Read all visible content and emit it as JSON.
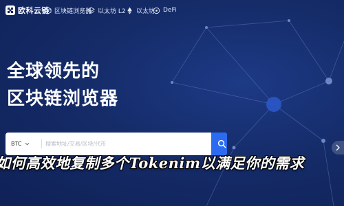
{
  "nav": {
    "brand": "欧科云链",
    "items": [
      {
        "label": "区块链浏览器",
        "icon": "cube-icon"
      },
      {
        "label": "以太坊 L2",
        "icon": "layers-icon"
      },
      {
        "label": "以太坊",
        "icon": "ethereum-icon"
      },
      {
        "label": "DeFi",
        "icon": "defi-icon"
      }
    ]
  },
  "hero": {
    "line1": "全球领先的",
    "line2": "区块链浏览器"
  },
  "search": {
    "coin": "BTC",
    "placeholder": "搜索地址/交易/区块/代币"
  },
  "overlay": {
    "headline": "如何高效地复制多个Tokenim以满足你的需求"
  },
  "colors": {
    "background": "#142a62",
    "accent": "#2b6bf1",
    "text": "#ffffff"
  }
}
